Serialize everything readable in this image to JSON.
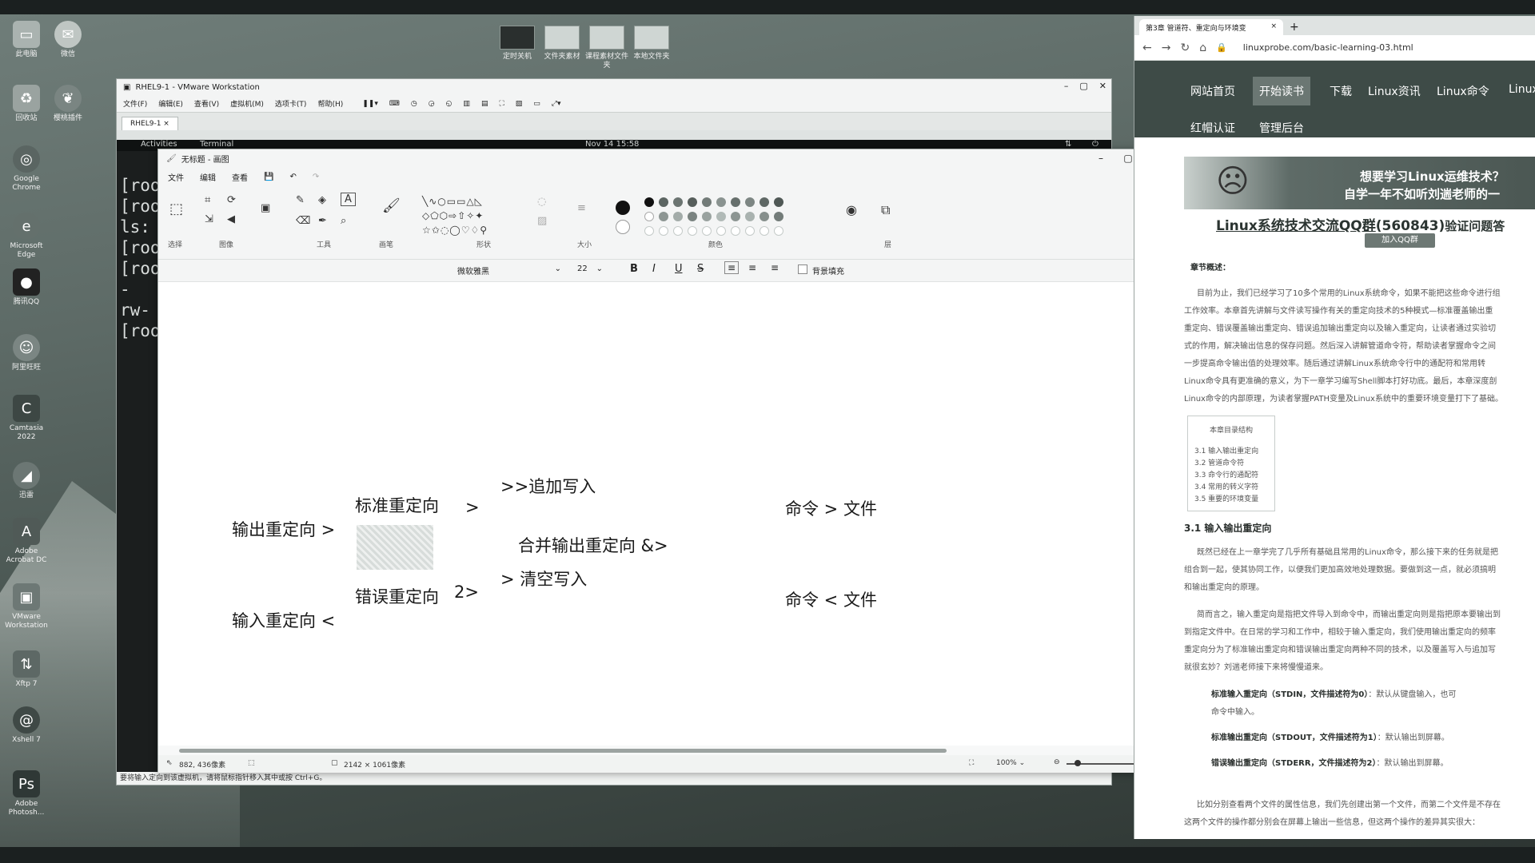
{
  "desktop": {
    "icons_left": [
      {
        "label": "此电脑",
        "icon": "computer-icon"
      },
      {
        "label": "回收站",
        "icon": "recycle-bin-icon"
      },
      {
        "label": "Google Chrome",
        "icon": "chrome-icon"
      },
      {
        "label": "Microsoft Edge",
        "icon": "edge-icon"
      },
      {
        "label": "腾讯QQ",
        "icon": "qq-icon"
      },
      {
        "label": "阿里旺旺",
        "icon": "aliwangwang-icon"
      },
      {
        "label": "Camtasia 2022",
        "icon": "camtasia-icon"
      },
      {
        "label": "迅雷",
        "icon": "xunlei-icon"
      },
      {
        "label": "Adobe Acrobat DC",
        "icon": "acrobat-icon"
      },
      {
        "label": "VMware Workstation",
        "icon": "vmware-icon"
      },
      {
        "label": "Xftp 7",
        "icon": "xftp-icon"
      },
      {
        "label": "Xshell 7",
        "icon": "xshell-icon"
      },
      {
        "label": "Adobe Photosh...",
        "icon": "photoshop-icon"
      }
    ],
    "icons_col2": [
      {
        "label": "微信",
        "icon": "wechat-icon"
      },
      {
        "label": "樱桃插件",
        "icon": "cherry-icon"
      }
    ],
    "icons_top": [
      {
        "label": "定时关机",
        "icon": "shortcut-icon"
      },
      {
        "label": "文件夹素材",
        "icon": "shortcut-icon"
      },
      {
        "label": "课程素材文件夹",
        "icon": "shortcut-icon"
      },
      {
        "label": "本地文件夹",
        "icon": "shortcut-icon"
      }
    ]
  },
  "vmware": {
    "title": "RHEL9-1 - VMware Workstation",
    "menu": [
      "文件(F)",
      "编辑(E)",
      "查看(V)",
      "虚拟机(M)",
      "选项卡(T)",
      "帮助(H)"
    ],
    "tab": "RHEL9-1",
    "gnome": {
      "activities": "Activities",
      "app": "Terminal",
      "clock": "Nov 14  15:58"
    },
    "terminal_lines": [
      "[roo",
      "[roo",
      "ls:",
      "[roo",
      "[roo",
      "-rw-",
      "[roo"
    ],
    "status": "要将输入定向到该虚拟机，请将鼠标指针移入其中或按 Ctrl+G。"
  },
  "paint": {
    "title": "无标题 - 画图",
    "menu": [
      "文件",
      "编辑",
      "查看"
    ],
    "groups": [
      "选择",
      "图像",
      "工具",
      "画笔",
      "形状",
      "大小",
      "颜色",
      "层"
    ],
    "font_name": "微软雅黑",
    "font_size": "22",
    "fill_label": "背景填充",
    "canvas_text": {
      "output_redirect": "输出重定向 >",
      "input_redirect": "输入重定向 <",
      "std_redirect": "标准重定向",
      "std_symbol": ">",
      "err_redirect": "错误重定向",
      "err_symbol": "2>",
      "append": ">>追加写入",
      "merge": "合并输出重定向 &>",
      "overwrite": "> 清空写入",
      "cmd_out": "命令 > 文件",
      "cmd_in": "命令 < 文件"
    },
    "status": {
      "cursor": "882, 436像素",
      "canvas_size": "2142 × 1061像素",
      "zoom": "100%"
    },
    "colors": {
      "row1": [
        "#111111",
        "#5c6562",
        "#6b7471",
        "#565e5b",
        "#727b78",
        "#8a9390",
        "#666f6c",
        "#7d8683",
        "#5f6865",
        "#4f5855"
      ],
      "row2": [
        "#ffffff",
        "#8d9693",
        "#a3aca9",
        "#7a8380",
        "#99a29f",
        "#b1bab7",
        "#8c9592",
        "#a9b2af",
        "#868f8c",
        "#737c79"
      ]
    }
  },
  "browser": {
    "tab_title": "第3章 管道符、重定向与环境变",
    "url": "linuxprobe.com/basic-learning-03.html",
    "nav_row1": [
      "网站首页",
      "开始读书",
      "下载",
      "Linux资讯",
      "Linux命令",
      "Linux..."
    ],
    "nav_row2": [
      "红帽认证",
      "管理后台"
    ],
    "banner_line1": "想要学习Linux运维技术？",
    "banner_line2": "自学一年不如听刘遄老师的一",
    "qq_title": "Linux系统技术交流QQ群",
    "qq_number": "(560843)",
    "qq_suffix": "验证问题答",
    "qq_button": "加入QQ群",
    "section_summary": "章节概述：",
    "para1": [
      "目前为止，我们已经学习了10多个常用的Linux系统命令，如果不能把这些命令进行组",
      "工作效率。本章首先讲解与文件读写操作有关的重定向技术的5种模式—标准覆盖输出重",
      "重定向、错误覆盖输出重定向、错误追加输出重定向以及输入重定向，让读者通过实验切",
      "式的作用，解决输出信息的保存问题。然后深入讲解管道命令符，帮助读者掌握命令之间",
      "一步提高命令输出值的处理效率。随后通过讲解Linux系统命令行中的通配符和常用转",
      "Linux命令具有更准确的意义，为下一章学习编写Shell脚本打好功底。最后，本章深度剖",
      "Linux命令的内部原理，为读者掌握PATH变量及Linux系统中的重要环境变量打下了基础。"
    ],
    "toc_title": "本章目录结构",
    "toc_items": [
      "3.1 输入输出重定向",
      "3.2 管道命令符",
      "3.3 命令行的通配符",
      "3.4 常用的转义字符",
      "3.5 重要的环境变量"
    ],
    "section_31": "3.1 输入输出重定向",
    "para2": [
      "既然已经在上一章学完了几乎所有基础且常用的Linux命令，那么接下来的任务就是把",
      "组合到一起，使其协同工作，以便我们更加高效地处理数据。要做到这一点，就必须搞明",
      "和输出重定向的原理。"
    ],
    "para3": [
      "简而言之，输入重定向是指把文件导入到命令中，而输出重定向则是指把原本要输出到",
      "到指定文件中。在日常的学习和工作中，相较于输入重定向，我们使用输出重定向的频率",
      "重定向分为了标准输出重定向和错误输出重定向两种不同的技术，以及覆盖写入与追加写",
      "就很玄妙？刘遄老师接下来将慢慢道来。"
    ],
    "bullets": [
      {
        "bold": "标准输入重定向（STDIN，文件描述符为0）",
        "rest": "：默认从键盘输入，也可"
      },
      {
        "bold": "",
        "rest": "命令中输入。"
      },
      {
        "bold": "标准输出重定向（STDOUT，文件描述符为1）",
        "rest": "：默认输出到屏幕。"
      },
      {
        "bold": "错误输出重定向（STDERR，文件描述符为2）",
        "rest": "：默认输出到屏幕。"
      }
    ],
    "para4": [
      "比如分别查看两个文件的属性信息，我们先创建出第一个文件，而第二个文件是不存在",
      "这两个文件的操作都分别会在屏幕上输出一些信息，但这两个操作的差异其实很大："
    ]
  }
}
